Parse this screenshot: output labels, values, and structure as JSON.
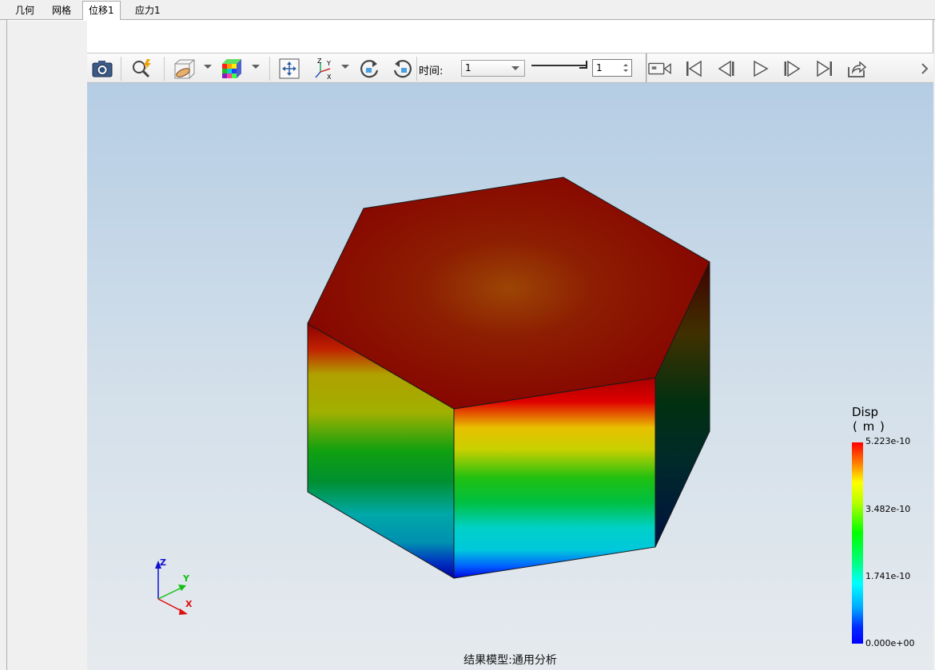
{
  "tabs": [
    {
      "label": "几何"
    },
    {
      "label": "网格"
    },
    {
      "label": "位移1",
      "active": true
    },
    {
      "label": "应力1"
    }
  ],
  "toolbar": {
    "icons": [
      "camera-icon",
      "pick-query-icon",
      "section-cube-icon",
      "colormap-cube-icon",
      "fit-view-icon",
      "axis-view-icon",
      "rotate-cw-icon",
      "rotate-ccw-icon",
      "record-video-icon",
      "first-frame-icon",
      "prev-frame-icon",
      "play-icon",
      "next-frame-icon",
      "last-frame-icon",
      "export-icon"
    ],
    "time_label": "时间:",
    "time_value": "1",
    "frame_value": "1"
  },
  "legend": {
    "title": "Disp",
    "unit": "( m )",
    "labels": [
      "5.223e-10",
      "3.482e-10",
      "1.741e-10",
      "0.000e+00"
    ],
    "colors": [
      "#ff0000",
      "#ffff00",
      "#00ff00",
      "#00ffff",
      "#0000ff"
    ]
  },
  "triad": {
    "x": "X",
    "y": "Y",
    "z": "Z"
  },
  "status_text": "结果模型:通用分析"
}
